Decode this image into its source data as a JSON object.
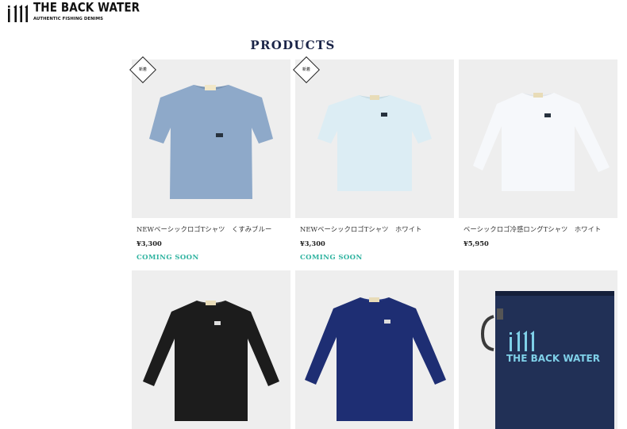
{
  "brand": {
    "title": "THE BACK WATER",
    "subtitle": "AUTHENTIC FISHING DENIMS"
  },
  "page": {
    "title": "PRODUCTS"
  },
  "colors": {
    "title_navy": "#1b2548",
    "coming_soon": "#2fb3a0",
    "tile_bg": "#eeeeee"
  },
  "products": [
    {
      "name": "NEWベーシックロゴTシャツ　くすみブルー",
      "price": "¥3,300",
      "status": "COMING SOON",
      "badge": "新着",
      "image": "dusty-blue-tshirt"
    },
    {
      "name": "NEWベーシックロゴTシャツ　ホワイト",
      "price": "¥3,300",
      "status": "COMING SOON",
      "badge": "新着",
      "image": "white-tshirt"
    },
    {
      "name": "ベーシックロゴ冷感ロングTシャツ　ホワイト",
      "price": "¥5,950",
      "status": "",
      "badge": "",
      "image": "white-long-sleeve"
    },
    {
      "name": "",
      "price": "",
      "status": "",
      "badge": "",
      "image": "black-long-sleeve"
    },
    {
      "name": "",
      "price": "",
      "status": "",
      "badge": "",
      "image": "navy-long-sleeve"
    },
    {
      "name": "",
      "price": "",
      "status": "",
      "badge": "",
      "image": "denim-pouch",
      "print": "THE BACK WATER"
    }
  ]
}
